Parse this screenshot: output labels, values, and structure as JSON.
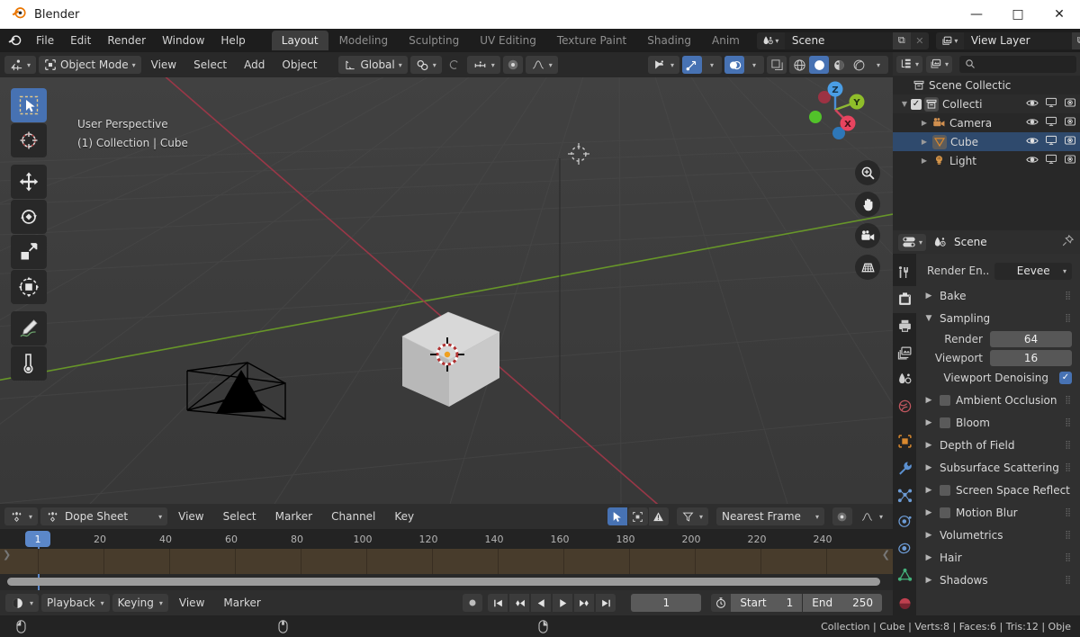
{
  "titlebar": {
    "app_title": "Blender",
    "minimize": "—",
    "maximize": "□",
    "close": "✕"
  },
  "topbar": {
    "menus": [
      "File",
      "Edit",
      "Render",
      "Window",
      "Help"
    ],
    "workspace_tabs": [
      {
        "label": "Layout",
        "active": true
      },
      {
        "label": "Modeling",
        "active": false
      },
      {
        "label": "Sculpting",
        "active": false
      },
      {
        "label": "UV Editing",
        "active": false
      },
      {
        "label": "Texture Paint",
        "active": false
      },
      {
        "label": "Shading",
        "active": false
      },
      {
        "label": "Anim",
        "active": false
      }
    ],
    "scene_field": {
      "value": "Scene",
      "new_btn": "⧉",
      "unlink_btn": "✕"
    },
    "viewlayer_field": {
      "value": "View Layer",
      "new_btn": "⧉",
      "unlink_btn": "✕"
    }
  },
  "viewport": {
    "mode": "Object Mode",
    "menus": [
      "View",
      "Select",
      "Add",
      "Object"
    ],
    "transform_orientation": "Global",
    "overlay_text_line1": "User Perspective",
    "overlay_text_line2": "(1) Collection | Cube",
    "gizmo_axes": [
      "Z",
      "Y",
      "X"
    ],
    "tools": [
      {
        "name": "select-box-tool",
        "active": true
      },
      {
        "name": "cursor-tool",
        "active": false
      },
      {
        "name": "move-tool",
        "active": false
      },
      {
        "name": "rotate-tool",
        "active": false
      },
      {
        "name": "scale-tool",
        "active": false
      },
      {
        "name": "transform-tool",
        "active": false
      },
      {
        "name": "annotate-tool",
        "active": false
      },
      {
        "name": "measure-tool",
        "active": false
      }
    ],
    "nav_buttons": [
      "zoom-icon",
      "hand-icon",
      "camera-icon",
      "grid-icon"
    ],
    "shading_modes": [
      "wireframe",
      "solid",
      "material-preview",
      "rendered"
    ],
    "active_shading": "solid"
  },
  "outliner": {
    "display_mode": "View Layer",
    "search_placeholder": "",
    "rows": [
      {
        "label": "Scene Collectic",
        "indent": 0,
        "icon": "collection-icon",
        "selected": false,
        "has_toggles": false,
        "has_checkbox": false,
        "has_disclosure": false
      },
      {
        "label": "Collecti",
        "indent": 1,
        "icon": "collection-icon",
        "selected": false,
        "has_toggles": true,
        "has_checkbox": true,
        "has_disclosure": true
      },
      {
        "label": "Camera",
        "indent": 2,
        "icon": "camera-icon",
        "selected": false,
        "has_toggles": true,
        "has_checkbox": false,
        "has_disclosure": true
      },
      {
        "label": "Cube",
        "indent": 2,
        "icon": "mesh-icon",
        "selected": true,
        "has_toggles": true,
        "has_checkbox": false,
        "has_disclosure": true
      },
      {
        "label": "Light",
        "indent": 2,
        "icon": "light-icon",
        "selected": false,
        "has_toggles": true,
        "has_checkbox": false,
        "has_disclosure": true
      }
    ],
    "toggle_icons": [
      "eye-icon",
      "monitor-icon",
      "camera-render-icon"
    ]
  },
  "properties": {
    "breadcrumb": "Scene",
    "pin_icon": "pin-icon",
    "tabs": [
      {
        "name": "tool-tab",
        "active": false
      },
      {
        "name": "render-tab",
        "active": true
      },
      {
        "name": "output-tab",
        "active": false
      },
      {
        "name": "view-layer-tab",
        "active": false
      },
      {
        "name": "scene-tab",
        "active": false
      },
      {
        "name": "world-tab",
        "active": false
      },
      {
        "name": "object-tab",
        "active": false
      },
      {
        "name": "modifier-tab",
        "active": false
      },
      {
        "name": "particles-tab",
        "active": false
      },
      {
        "name": "physics-tab",
        "active": false
      },
      {
        "name": "constraints-tab",
        "active": false
      },
      {
        "name": "data-tab",
        "active": false
      },
      {
        "name": "material-tab",
        "active": false
      }
    ],
    "render_engine_label": "Render En..",
    "render_engine_value": "Eevee",
    "panels": [
      {
        "label": "Bake",
        "open": false,
        "checkbox": false,
        "has_grip": true
      },
      {
        "label": "Sampling",
        "open": true,
        "checkbox": false,
        "has_grip": true
      },
      {
        "label": "Ambient Occlusion",
        "open": false,
        "checkbox": true,
        "has_grip": true
      },
      {
        "label": "Bloom",
        "open": false,
        "checkbox": true,
        "has_grip": true
      },
      {
        "label": "Depth of Field",
        "open": false,
        "checkbox": false,
        "has_grip": true
      },
      {
        "label": "Subsurface Scattering",
        "open": false,
        "checkbox": false,
        "has_grip": true
      },
      {
        "label": "Screen Space Reflect",
        "open": false,
        "checkbox": true,
        "has_grip": false
      },
      {
        "label": "Motion Blur",
        "open": false,
        "checkbox": true,
        "has_grip": true
      },
      {
        "label": "Volumetrics",
        "open": false,
        "checkbox": false,
        "has_grip": true
      },
      {
        "label": "Hair",
        "open": false,
        "checkbox": false,
        "has_grip": true
      },
      {
        "label": "Shadows",
        "open": false,
        "checkbox": false,
        "has_grip": true
      }
    ],
    "sampling": {
      "render_label": "Render",
      "render_value": "64",
      "viewport_label": "Viewport",
      "viewport_value": "16",
      "denoising_label": "Viewport Denoising",
      "denoising_checked": true
    }
  },
  "dopesheet": {
    "editor_name": "Dope Sheet",
    "menus": [
      "View",
      "Select",
      "Marker",
      "Channel",
      "Key"
    ],
    "snap_mode": "Nearest Frame",
    "ticks": [
      20,
      40,
      60,
      80,
      100,
      120,
      140,
      160,
      180,
      200,
      220,
      240
    ],
    "current_frame": "1",
    "filter_icons": [
      "cursor-icon",
      "select-only-icon",
      "error-icon",
      "filter-icon",
      "proportional-icon",
      "falloff-icon"
    ]
  },
  "timeline": {
    "mode_dropdown": "playback-mode-icon",
    "menus_dd": [
      "Playback",
      "Keying"
    ],
    "menus": [
      "View",
      "Marker"
    ],
    "transport": [
      "record-icon",
      "jump-start-icon",
      "prev-keyframe-icon",
      "play-reverse-icon",
      "play-icon",
      "next-keyframe-icon",
      "jump-end-icon"
    ],
    "current_frame": "1",
    "start_label": "Start",
    "start_value": "1",
    "end_label": "End",
    "end_value": "250"
  },
  "statusbar": {
    "hints": [
      "mouse-left-icon",
      "mouse-middle-icon",
      "mouse-right-icon"
    ],
    "stats": "Collection | Cube | Verts:8 | Faces:6 | Tris:12 | Obje"
  },
  "colors": {
    "accent_blue": "#4772b3",
    "playhead_blue": "#5b87c9",
    "viewport_bg": "#3b3b3b",
    "axis_green": "#7bb51f",
    "axis_red": "#c1364a",
    "panel_bg": "#303030"
  }
}
